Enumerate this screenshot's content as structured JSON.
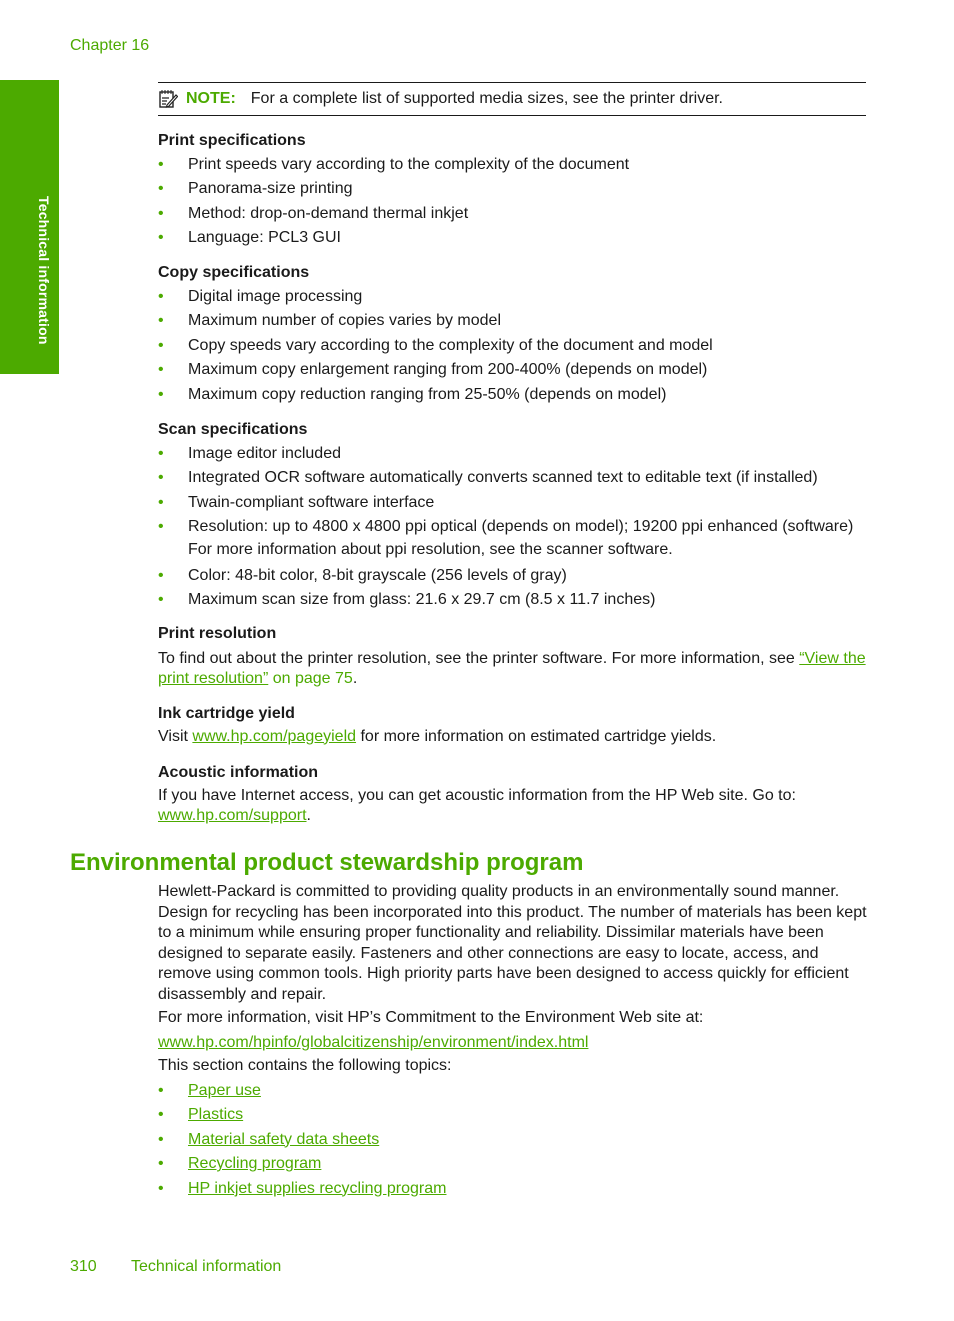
{
  "header": {
    "chapter": "Chapter 16"
  },
  "side_tab": {
    "label": "Technical information"
  },
  "note": {
    "icon": "note-pad-icon",
    "label": "NOTE:",
    "text": "For a complete list of supported media sizes, see the printer driver."
  },
  "print_specs": {
    "heading": "Print specifications",
    "items": [
      "Print speeds vary according to the complexity of the document",
      "Panorama-size printing",
      "Method: drop-on-demand thermal inkjet",
      "Language: PCL3 GUI"
    ]
  },
  "copy_specs": {
    "heading": "Copy specifications",
    "items": [
      "Digital image processing",
      "Maximum number of copies varies by model",
      "Copy speeds vary according to the complexity of the document and model",
      "Maximum copy enlargement ranging from 200-400% (depends on model)",
      "Maximum copy reduction ranging from 25-50% (depends on model)"
    ]
  },
  "scan_specs": {
    "heading": "Scan specifications",
    "items": [
      "Image editor included",
      "Integrated OCR software automatically converts scanned text to editable text (if installed)",
      "Twain-compliant software interface",
      "Resolution: up to 4800 x 4800 ppi optical (depends on model); 19200 ppi enhanced (software)",
      "Color: 48-bit color, 8-bit grayscale (256 levels of gray)",
      "Maximum scan size from glass: 21.6 x 29.7 cm (8.5 x 11.7 inches)"
    ],
    "resolution_note": "For more information about ppi resolution, see the scanner software."
  },
  "print_resolution": {
    "heading": "Print resolution",
    "text_before": "To find out about the printer resolution, see the printer software. For more information, see ",
    "link_text": "“View the print resolution”",
    "link_suffix": " on page 75",
    "text_after": "."
  },
  "ink_yield": {
    "heading": "Ink cartridge yield",
    "text_before": "Visit ",
    "link_text": "www.hp.com/pageyield",
    "text_after": " for more information on estimated cartridge yields."
  },
  "acoustic": {
    "heading": "Acoustic information",
    "text_before": "If you have Internet access, you can get acoustic information from the HP Web site. Go to: ",
    "link_text": "www.hp.com/support",
    "text_after": "."
  },
  "environment": {
    "heading": "Environmental product stewardship program",
    "paragraph": "Hewlett-Packard is committed to providing quality products in an environmentally sound manner. Design for recycling has been incorporated into this product. The number of materials has been kept to a minimum while ensuring proper functionality and reliability. Dissimilar materials have been designed to separate easily. Fasteners and other connections are easy to locate, access, and remove using common tools. High priority parts have been designed to access quickly for efficient disassembly and repair.",
    "more_info": "For more information, visit HP’s Commitment to the Environment Web site at:",
    "url": "www.hp.com/hpinfo/globalcitizenship/environment/index.html",
    "topics_intro": "This section contains the following topics:",
    "topics": [
      "Paper use",
      "Plastics",
      "Material safety data sheets",
      "Recycling program",
      "HP inkjet supplies recycling program"
    ]
  },
  "footer": {
    "page_number": "310",
    "section": "Technical information"
  },
  "bullet": "•"
}
